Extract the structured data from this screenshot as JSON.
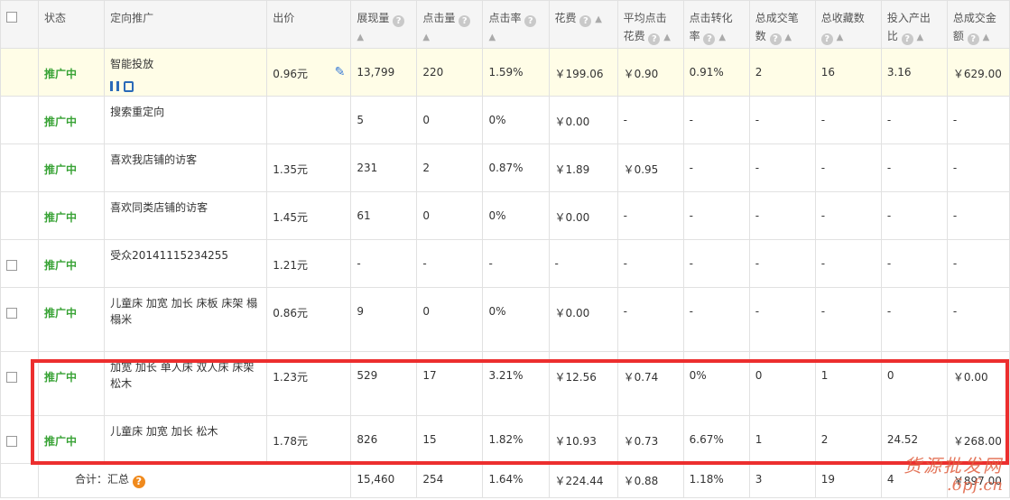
{
  "columns": {
    "status": "状态",
    "target": "定向推广",
    "bid": "出价",
    "impressions": "展现量",
    "clicks": "点击量",
    "ctr": "点击率",
    "cost": "花费",
    "avg_cpc_1": "平均点击",
    "avg_cpc_2": "花费",
    "cvr_1": "点击转化",
    "cvr_2": "率",
    "orders_1": "总成交笔",
    "orders_2": "数",
    "favorites": "总收藏数",
    "roi_1": "投入产出",
    "roi_2": "比",
    "gmv_1": "总成交金",
    "gmv_2": "额"
  },
  "rows": [
    {
      "checkbox": false,
      "status": "推广中",
      "name": "智能投放",
      "bid": "0.96元",
      "imp": "13,799",
      "clk": "220",
      "ctr": "1.59%",
      "cost": "￥199.06",
      "cpc": "￥0.90",
      "cvr": "0.91%",
      "orders": "2",
      "fav": "16",
      "roi": "3.16",
      "gmv": "￥629.00",
      "highlight": true
    },
    {
      "checkbox": false,
      "status": "推广中",
      "name": "搜索重定向",
      "bid": "",
      "imp": "5",
      "clk": "0",
      "ctr": "0%",
      "cost": "￥0.00",
      "cpc": "-",
      "cvr": "-",
      "orders": "-",
      "fav": "-",
      "roi": "-",
      "gmv": "-"
    },
    {
      "checkbox": false,
      "status": "推广中",
      "name": "喜欢我店铺的访客",
      "bid": "1.35元",
      "imp": "231",
      "clk": "2",
      "ctr": "0.87%",
      "cost": "￥1.89",
      "cpc": "￥0.95",
      "cvr": "-",
      "orders": "-",
      "fav": "-",
      "roi": "-",
      "gmv": "-"
    },
    {
      "checkbox": false,
      "status": "推广中",
      "name": "喜欢同类店铺的访客",
      "bid": "1.45元",
      "imp": "61",
      "clk": "0",
      "ctr": "0%",
      "cost": "￥0.00",
      "cpc": "-",
      "cvr": "-",
      "orders": "-",
      "fav": "-",
      "roi": "-",
      "gmv": "-"
    },
    {
      "checkbox": true,
      "status": "推广中",
      "name": "受众20141115234255",
      "bid": "1.21元",
      "imp": "-",
      "clk": "-",
      "ctr": "-",
      "cost": "-",
      "cpc": "-",
      "cvr": "-",
      "orders": "-",
      "fav": "-",
      "roi": "-",
      "gmv": "-"
    },
    {
      "checkbox": true,
      "status": "推广中",
      "name": "儿童床 加宽 加长 床板 床架 榻榻米",
      "bid": "0.86元",
      "imp": "9",
      "clk": "0",
      "ctr": "0%",
      "cost": "￥0.00",
      "cpc": "-",
      "cvr": "-",
      "orders": "-",
      "fav": "-",
      "roi": "-",
      "gmv": "-"
    },
    {
      "checkbox": true,
      "status": "推广中",
      "name": "加宽 加长 单人床 双人床 床架 松木",
      "bid": "1.23元",
      "imp": "529",
      "clk": "17",
      "ctr": "3.21%",
      "cost": "￥12.56",
      "cpc": "￥0.74",
      "cvr": "0%",
      "orders": "0",
      "fav": "1",
      "roi": "0",
      "gmv": "￥0.00"
    },
    {
      "checkbox": true,
      "status": "推广中",
      "name": "儿童床 加宽 加长 松木",
      "bid": "1.78元",
      "imp": "826",
      "clk": "15",
      "ctr": "1.82%",
      "cost": "￥10.93",
      "cpc": "￥0.73",
      "cvr": "6.67%",
      "orders": "1",
      "fav": "2",
      "roi": "24.52",
      "gmv": "￥268.00"
    }
  ],
  "total": {
    "label": "合计：汇总",
    "imp": "15,460",
    "clk": "254",
    "ctr": "1.64%",
    "cost": "￥224.44",
    "cpc": "￥0.88",
    "cvr": "1.18%",
    "orders": "3",
    "fav": "19",
    "roi": "4",
    "gmv": "￥897.00"
  },
  "watermark": {
    "line1": "货源批发网",
    "line2": ".6pf.cn"
  }
}
